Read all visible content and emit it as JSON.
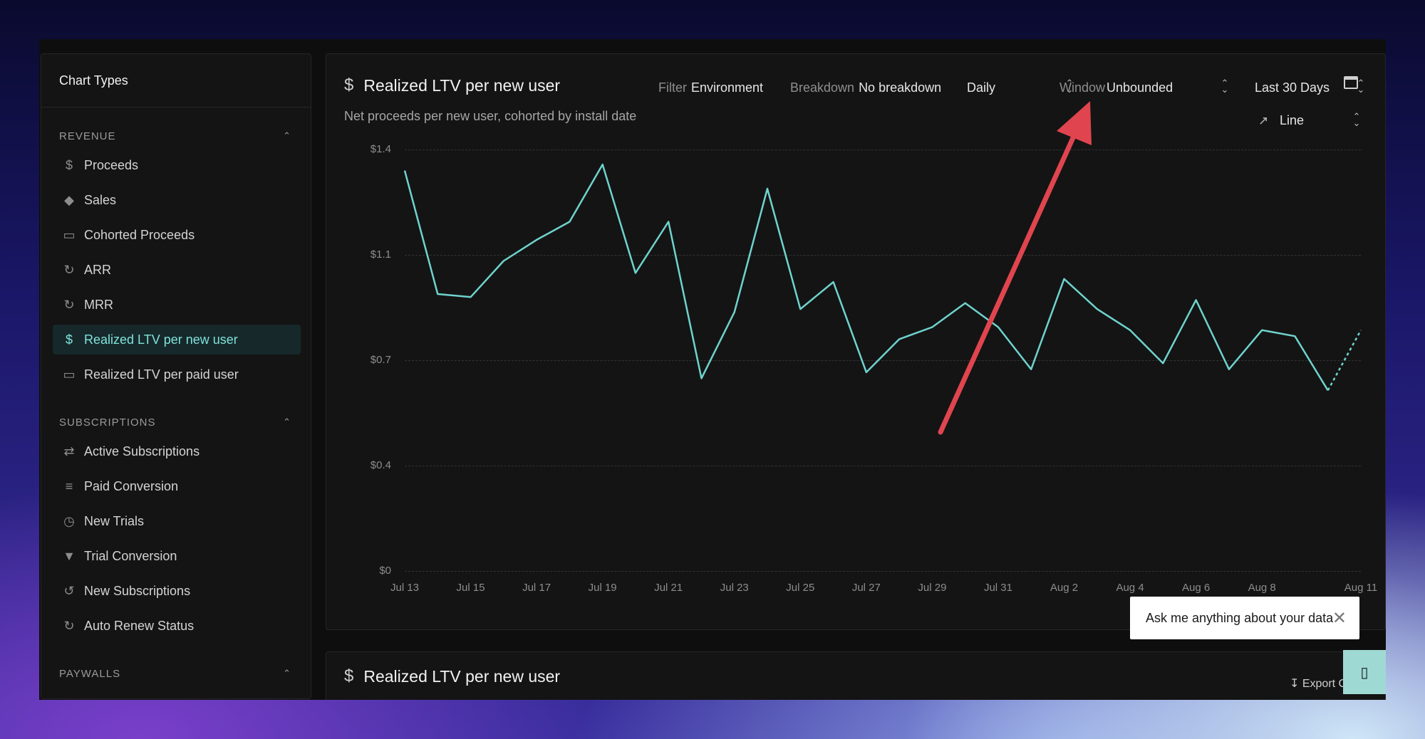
{
  "sidebar": {
    "title": "Chart Types",
    "sections": [
      {
        "label": "REVENUE",
        "items": [
          "Proceeds",
          "Sales",
          "Cohorted Proceeds",
          "ARR",
          "MRR",
          "Realized LTV per new user",
          "Realized LTV per paid user"
        ]
      },
      {
        "label": "SUBSCRIPTIONS",
        "items": [
          "Active Subscriptions",
          "Paid Conversion",
          "New Trials",
          "Trial Conversion",
          "New Subscriptions",
          "Auto Renew Status"
        ]
      },
      {
        "label": "PAYWALLS",
        "items": []
      }
    ],
    "active_item": "Realized LTV per new user"
  },
  "card": {
    "title": "Realized LTV per new user",
    "subtitle": "Net proceeds per new user, cohorted by install date",
    "filter_label": "Filter",
    "filter_value": "Environment",
    "breakdown_label": "Breakdown",
    "breakdown_value": "No breakdown",
    "resolution": "Daily",
    "window_label": "Window",
    "window_value": "Unbounded",
    "range": "Last 30 Days",
    "chart_type_label": "Line"
  },
  "card2": {
    "title": "Realized LTV per new user",
    "export_label": "Export C"
  },
  "assistant": {
    "prompt": "Ask me anything about your data"
  },
  "colors": {
    "accent": "#7fe3dc",
    "line": "#6fd3cd",
    "arrow": "#e0454f"
  },
  "chart_data": {
    "type": "line",
    "title": "Realized LTV per new user",
    "y_ticks": [
      "$0",
      "$0.4",
      "$0.7",
      "$1.1",
      "$1.4"
    ],
    "x_tick_labels": [
      "Jul 13",
      "Jul 15",
      "Jul 17",
      "Jul 19",
      "Jul 21",
      "Jul 23",
      "Jul 25",
      "Jul 27",
      "Jul 29",
      "Jul 31",
      "Aug 2",
      "Aug 4",
      "Aug 6",
      "Aug 8",
      "Aug 11"
    ],
    "x": [
      "Jul 13",
      "Jul 14",
      "Jul 15",
      "Jul 16",
      "Jul 17",
      "Jul 18",
      "Jul 19",
      "Jul 20",
      "Jul 21",
      "Jul 22",
      "Jul 23",
      "Jul 24",
      "Jul 25",
      "Jul 26",
      "Jul 27",
      "Jul 28",
      "Jul 29",
      "Jul 30",
      "Jul 31",
      "Aug 1",
      "Aug 2",
      "Aug 3",
      "Aug 4",
      "Aug 5",
      "Aug 6",
      "Aug 7",
      "Aug 8",
      "Aug 9",
      "Aug 10",
      "Aug 11"
    ],
    "values": [
      1.33,
      0.92,
      0.91,
      1.03,
      1.1,
      1.16,
      1.35,
      0.99,
      1.16,
      0.64,
      0.86,
      1.27,
      0.87,
      0.96,
      0.66,
      0.77,
      0.81,
      0.89,
      0.81,
      0.67,
      0.97,
      0.87,
      0.8,
      0.69,
      0.9,
      0.67,
      0.8,
      0.78,
      0.6,
      0.8
    ],
    "partial_last_segment": true,
    "ylim": [
      0,
      1.4
    ],
    "grid": true
  }
}
